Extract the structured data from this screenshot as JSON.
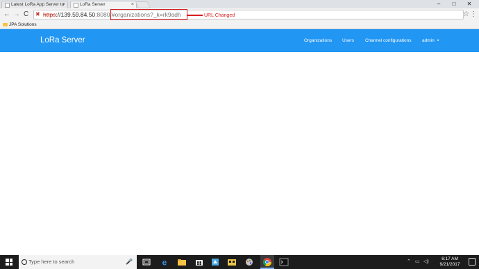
{
  "browser": {
    "tabs": [
      {
        "label": "Latest LoRa App Server tu",
        "active": false
      },
      {
        "label": "LoRa Server",
        "active": true
      }
    ],
    "window_controls": {
      "minimize": "–",
      "maximize": "□",
      "close": "✕"
    },
    "nav": {
      "back": "←",
      "forward": "→",
      "reload": "C"
    },
    "address": {
      "scheme": "https",
      "host": "://139.59.84.50",
      "path_muted": ":8080/#",
      "path_highlight": "organizations?_k=rk9adh"
    },
    "annotation": "URL Changed",
    "bookmarks": [
      {
        "label": "JPA Solutions"
      }
    ]
  },
  "app": {
    "brand": "LoRa Server",
    "nav": {
      "organizations": "Organizations",
      "users": "Users",
      "channel_configurations": "Channel configurations",
      "user_menu": "admin"
    },
    "colors": {
      "header": "#2196f3",
      "annotation": "#d81c1c"
    }
  },
  "taskbar": {
    "search_placeholder": "Type here to search",
    "time": "6:17 AM",
    "date": "9/21/2017",
    "icons": [
      "task-view-icon",
      "edge-icon",
      "store-icon",
      "briefcase-icon",
      "files-icon",
      "app-icon",
      "chrome-icon",
      "paint-icon",
      "terminal-icon"
    ]
  }
}
